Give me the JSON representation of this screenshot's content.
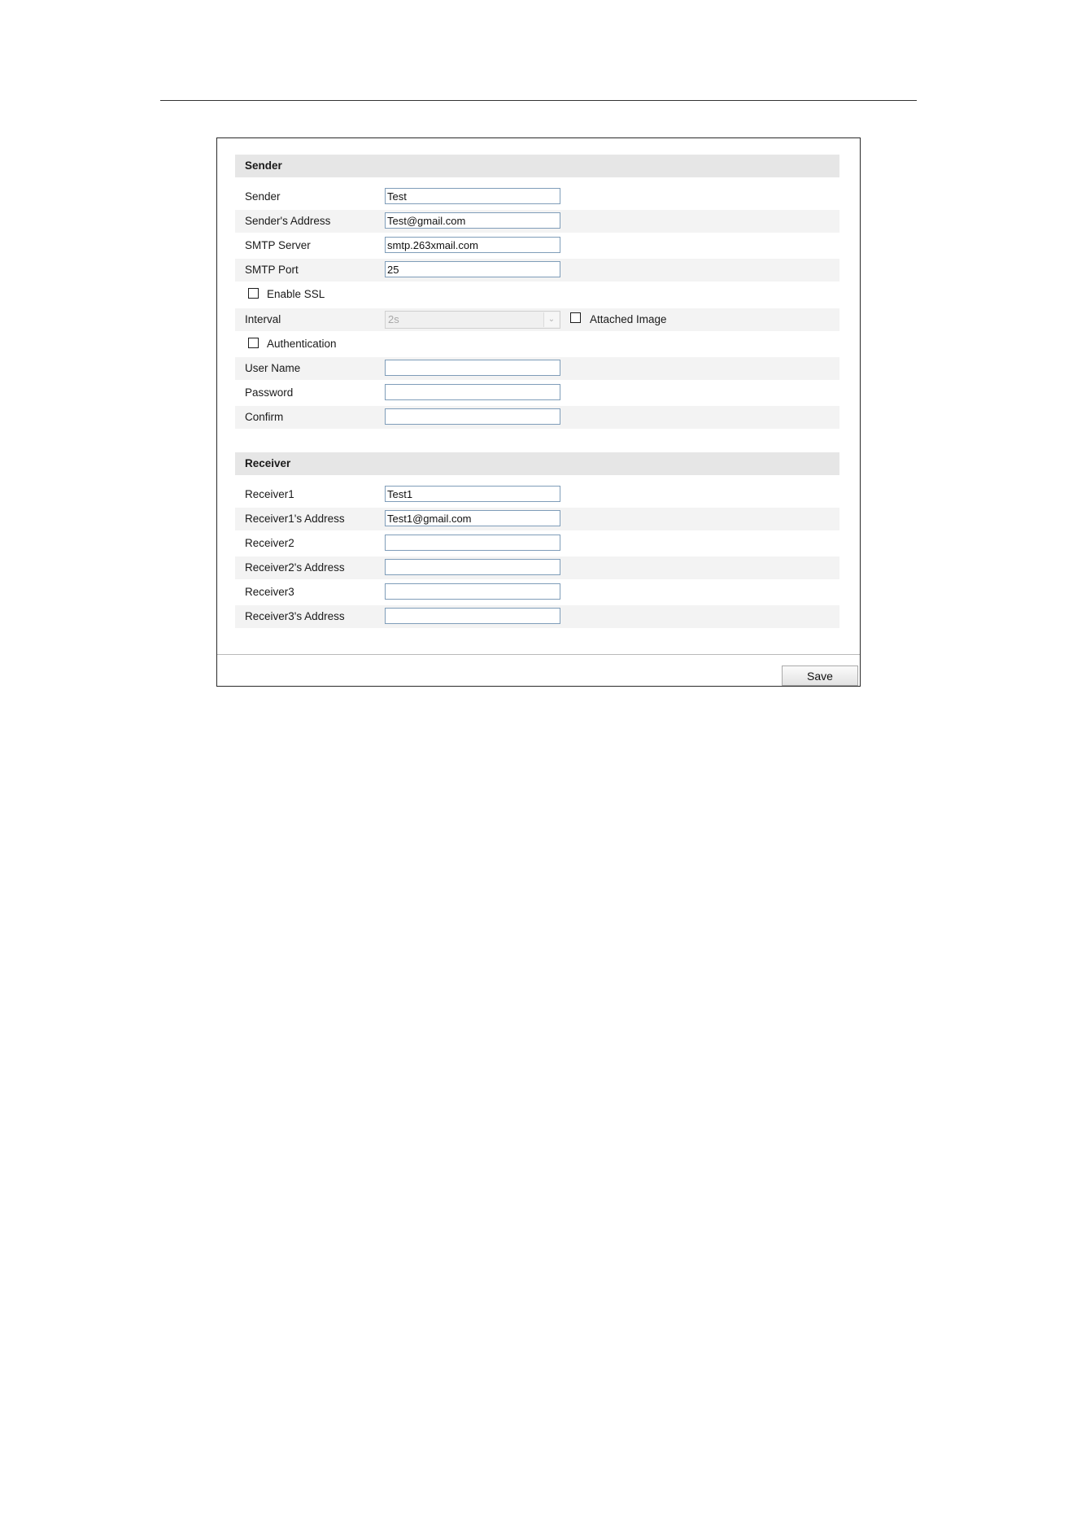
{
  "sender_section": {
    "title": "Sender",
    "sender": {
      "label": "Sender",
      "value": "Test"
    },
    "sender_address": {
      "label": "Sender's Address",
      "value": "Test@gmail.com"
    },
    "smtp_server": {
      "label": "SMTP Server",
      "value": "smtp.263xmail.com"
    },
    "smtp_port": {
      "label": "SMTP Port",
      "value": "25"
    },
    "enable_ssl": {
      "label": "Enable SSL",
      "checked": false
    },
    "interval": {
      "label": "Interval",
      "value": "2s",
      "disabled": true
    },
    "attached_image": {
      "label": "Attached Image",
      "checked": false
    },
    "authentication": {
      "label": "Authentication",
      "checked": false
    },
    "user_name": {
      "label": "User Name",
      "value": ""
    },
    "password": {
      "label": "Password",
      "value": ""
    },
    "confirm": {
      "label": "Confirm",
      "value": ""
    }
  },
  "receiver_section": {
    "title": "Receiver",
    "receiver1": {
      "label": "Receiver1",
      "value": "Test1"
    },
    "receiver1_address": {
      "label": "Receiver1's Address",
      "value": "Test1@gmail.com"
    },
    "receiver2": {
      "label": "Receiver2",
      "value": ""
    },
    "receiver2_address": {
      "label": "Receiver2's Address",
      "value": ""
    },
    "receiver3": {
      "label": "Receiver3",
      "value": ""
    },
    "receiver3_address": {
      "label": "Receiver3's Address",
      "value": ""
    }
  },
  "footer": {
    "save_label": "Save"
  },
  "icons": {
    "dropdown": "chevron-down-icon"
  }
}
